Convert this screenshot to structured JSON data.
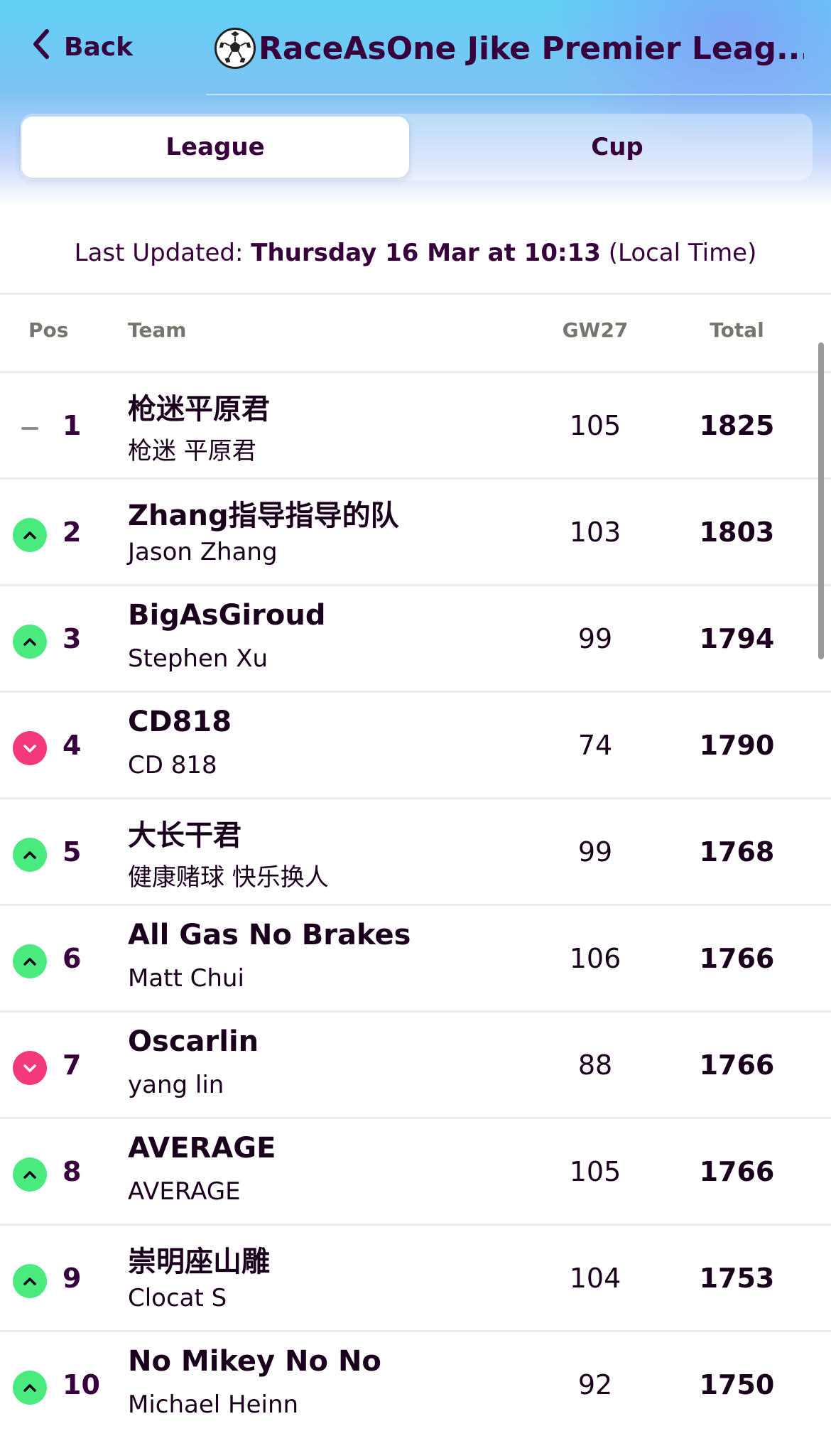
{
  "header": {
    "back_label": "Back",
    "title": "RaceAsOne Jike Premier Leag..."
  },
  "tabs": [
    {
      "label": "League",
      "active": true
    },
    {
      "label": "Cup",
      "active": false
    }
  ],
  "last_updated": {
    "prefix": "Last Updated:",
    "datetime": "Thursday 16 Mar at 10:13",
    "suffix": "(Local Time)"
  },
  "columns": {
    "pos": "Pos",
    "team": "Team",
    "gw": "GW27",
    "total": "Total"
  },
  "rows": [
    {
      "movement": "same",
      "pos": "1",
      "team": "枪迷平原君",
      "manager": "枪迷 平原君",
      "gw": "105",
      "total": "1825"
    },
    {
      "movement": "up",
      "pos": "2",
      "team": "Zhang指导指导的队",
      "manager": "Jason Zhang",
      "gw": "103",
      "total": "1803"
    },
    {
      "movement": "up",
      "pos": "3",
      "team": "BigAsGiroud",
      "manager": "Stephen Xu",
      "gw": "99",
      "total": "1794"
    },
    {
      "movement": "down",
      "pos": "4",
      "team": "CD818",
      "manager": "CD 818",
      "gw": "74",
      "total": "1790"
    },
    {
      "movement": "up",
      "pos": "5",
      "team": "大长干君",
      "manager": "健康赌球 快乐换人",
      "gw": "99",
      "total": "1768"
    },
    {
      "movement": "up",
      "pos": "6",
      "team": "All Gas No Brakes",
      "manager": "Matt Chui",
      "gw": "106",
      "total": "1766"
    },
    {
      "movement": "down",
      "pos": "7",
      "team": "Oscarlin",
      "manager": "yang lin",
      "gw": "88",
      "total": "1766"
    },
    {
      "movement": "up",
      "pos": "8",
      "team": "AVERAGE",
      "manager": " AVERAGE",
      "gw": "105",
      "total": "1766"
    },
    {
      "movement": "up",
      "pos": "9",
      "team": "崇明座山雕",
      "manager": "Clocat S",
      "gw": "104",
      "total": "1753"
    },
    {
      "movement": "up",
      "pos": "10",
      "team": "No Mikey No No",
      "manager": "Michael Heinn",
      "gw": "92",
      "total": "1750"
    }
  ],
  "colors": {
    "primary": "#37003c",
    "up": "#4bea7e",
    "down": "#f4387c",
    "divider": "#ececec"
  }
}
